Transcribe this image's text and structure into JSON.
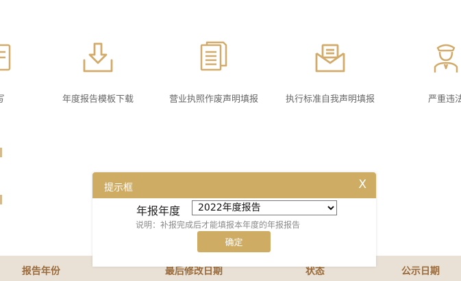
{
  "icons": [
    {
      "label": "写",
      "icon": "edit-icon"
    },
    {
      "label": "年度报告模板下载",
      "icon": "download-icon"
    },
    {
      "label": "营业执照作废声明填报",
      "icon": "document-icon"
    },
    {
      "label": "执行标准自我声明填报",
      "icon": "envelope-icon"
    },
    {
      "label": "严重违法",
      "icon": "officer-icon"
    }
  ],
  "table": {
    "headers": [
      "报告年份",
      "最后修改日期",
      "状态",
      "公示日期"
    ]
  },
  "dialog": {
    "title": "提示框",
    "close": "X",
    "field_label": "年报年度",
    "select_value": "2022年度报告",
    "note": "说明：补报完成后才能填报本年度的年报报告",
    "confirm": "确定"
  },
  "colors": {
    "accent": "#cfac63",
    "icon": "#d2aa6a",
    "header_bg": "#e9e1d6",
    "header_text": "#9a6a3a"
  }
}
